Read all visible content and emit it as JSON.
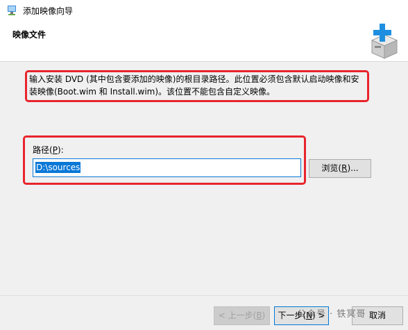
{
  "window": {
    "title": "添加映像向导",
    "app_icon": "wizard-icon"
  },
  "header": {
    "title": "映像文件",
    "icon": "box-plus-icon"
  },
  "instruction": {
    "text": "输入安装 DVD (其中包含要添加的映像)的根目录路径。此位置必须包含默认启动映像和安装映像(Boot.wim 和 Install.wim)。该位置不能包含自定义映像。"
  },
  "path_field": {
    "label_prefix": "路径(",
    "label_key": "P",
    "label_suffix": "):",
    "value": "D:\\sources"
  },
  "browse_button": {
    "prefix": "浏览(",
    "key": "R",
    "suffix": ")..."
  },
  "footer": {
    "prev": {
      "prefix": "< 上一步(",
      "key": "B",
      "suffix": ")"
    },
    "next": {
      "prefix": "下一步(",
      "key": "N",
      "suffix": ") >"
    },
    "cancel": "取消"
  },
  "watermark": "公众号 · 铁冥哥",
  "colors": {
    "highlight": "#e8242c",
    "selection": "#0a78d7"
  }
}
